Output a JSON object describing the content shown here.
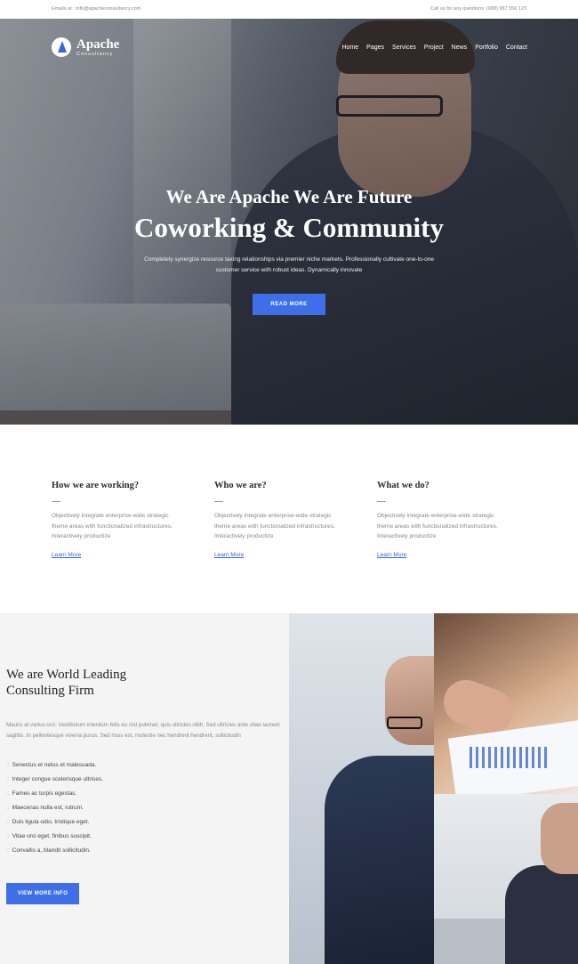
{
  "topbar": {
    "email": "Emails at : info@apacheconsultancy.com",
    "call": "Call us for any questions: (088) 987 556 123"
  },
  "brand": {
    "name": "Apache",
    "tagline": "Consultancy",
    "accent": "#3e6ee8"
  },
  "nav": {
    "items": [
      "Home",
      "Pages",
      "Services",
      "Project",
      "News",
      "Portfolio",
      "Contact"
    ]
  },
  "hero": {
    "line1": "We Are Apache We Are Future",
    "line2": "Coworking & Community",
    "text": "Completely synergize resource taxing relationships via premier niche markets. Professionally cultivate one-to-one customer service with robust ideas. Dynamically innovate",
    "button": "READ MORE"
  },
  "features": [
    {
      "title": "How we are working?",
      "text": "Objectively integrate enterprise-wide strategic theme areas with functionalized infrastructures. Interactively productize",
      "link": "Learn More"
    },
    {
      "title": "Who we are?",
      "text": "Objectively integrate enterprise-wide strategic theme areas with functionalized infrastructures. Interactively productize",
      "link": "Learn More"
    },
    {
      "title": "What we do?",
      "text": "Objectively integrate enterprise-wide strategic theme areas with functionalized infrastructures. Interactively productize",
      "link": "Learn More"
    }
  ],
  "consult": {
    "title_line1": "We are World Leading",
    "title_line2": "Consulting Firm",
    "intro": "Mauris at varius orci. Vestibulum interdum felis eu nisl pulvinar, quis ultricies nibh. Sed ultricies ante vitae laoreet sagittis. In pellentesque viverra purus. Sed risus est, molestie nec hendrerit hendrerit, sollicitudin",
    "list": [
      "Senectus et netus et malesuada.",
      "Integer congue scelerisque ultrices.",
      "Fames ac turpis egestas.",
      "Maecenas nulla est, rutrum.",
      "Duis ligula odio, tristique eget.",
      "Vitae orci eget, finibus suscipit.",
      "Convallis a, blandit sollicitudin."
    ],
    "button": "VIEW MORE INFO"
  }
}
